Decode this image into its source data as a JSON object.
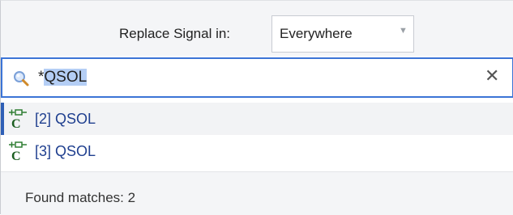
{
  "replace": {
    "label": "Replace Signal in:",
    "scope_value": "Everywhere",
    "scope_arrow_icon": "chevron-down-icon"
  },
  "search": {
    "prefix": "*",
    "query": "QSOL",
    "clear_icon": "close-icon",
    "search_icon": "magnifier-icon"
  },
  "results": {
    "items": [
      {
        "label": "[2] QSOL",
        "icon": "constant-signal-icon",
        "selected": true
      },
      {
        "label": "[3] QSOL",
        "icon": "constant-signal-icon",
        "selected": false
      }
    ]
  },
  "footer": {
    "found_text": "Found matches: 2"
  },
  "colors": {
    "accent": "#3b74d6",
    "selection_highlight": "#b4cef5",
    "selected_marker": "#2f5fb6",
    "result_text": "#1f3f8f",
    "icon_green": "#2e7d32"
  }
}
